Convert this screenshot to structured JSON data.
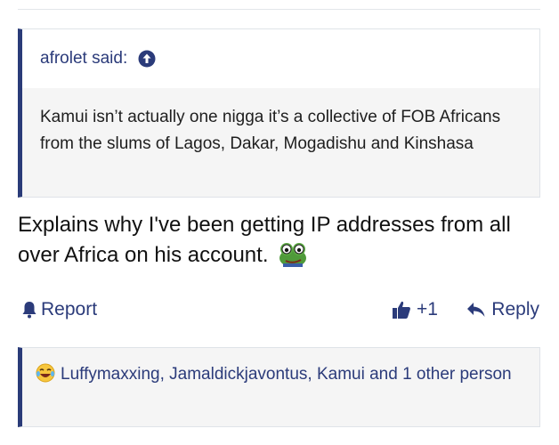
{
  "quote": {
    "author_line": "afrolet said:",
    "text": "Kamui isn’t actually one nigga it’s a collective of FOB Africans from the slums of Lagos, Dakar, Mogadishu and Kinshasa"
  },
  "post": {
    "text": "Explains why I've been getting IP addresses from all over Africa on his account.",
    "emoji": "frog-emoji"
  },
  "actions": {
    "report_label": "Report",
    "like_label": "+1",
    "reply_label": "Reply"
  },
  "reactions": {
    "text": "Luffymaxxing, Jamaldickjavontus, Kamui and 1 other person",
    "icon": "laughing-emoji"
  },
  "colors": {
    "accent": "#2b3b7a",
    "quote_border": "#2a3b78",
    "quote_bg": "#f5f5f5"
  }
}
